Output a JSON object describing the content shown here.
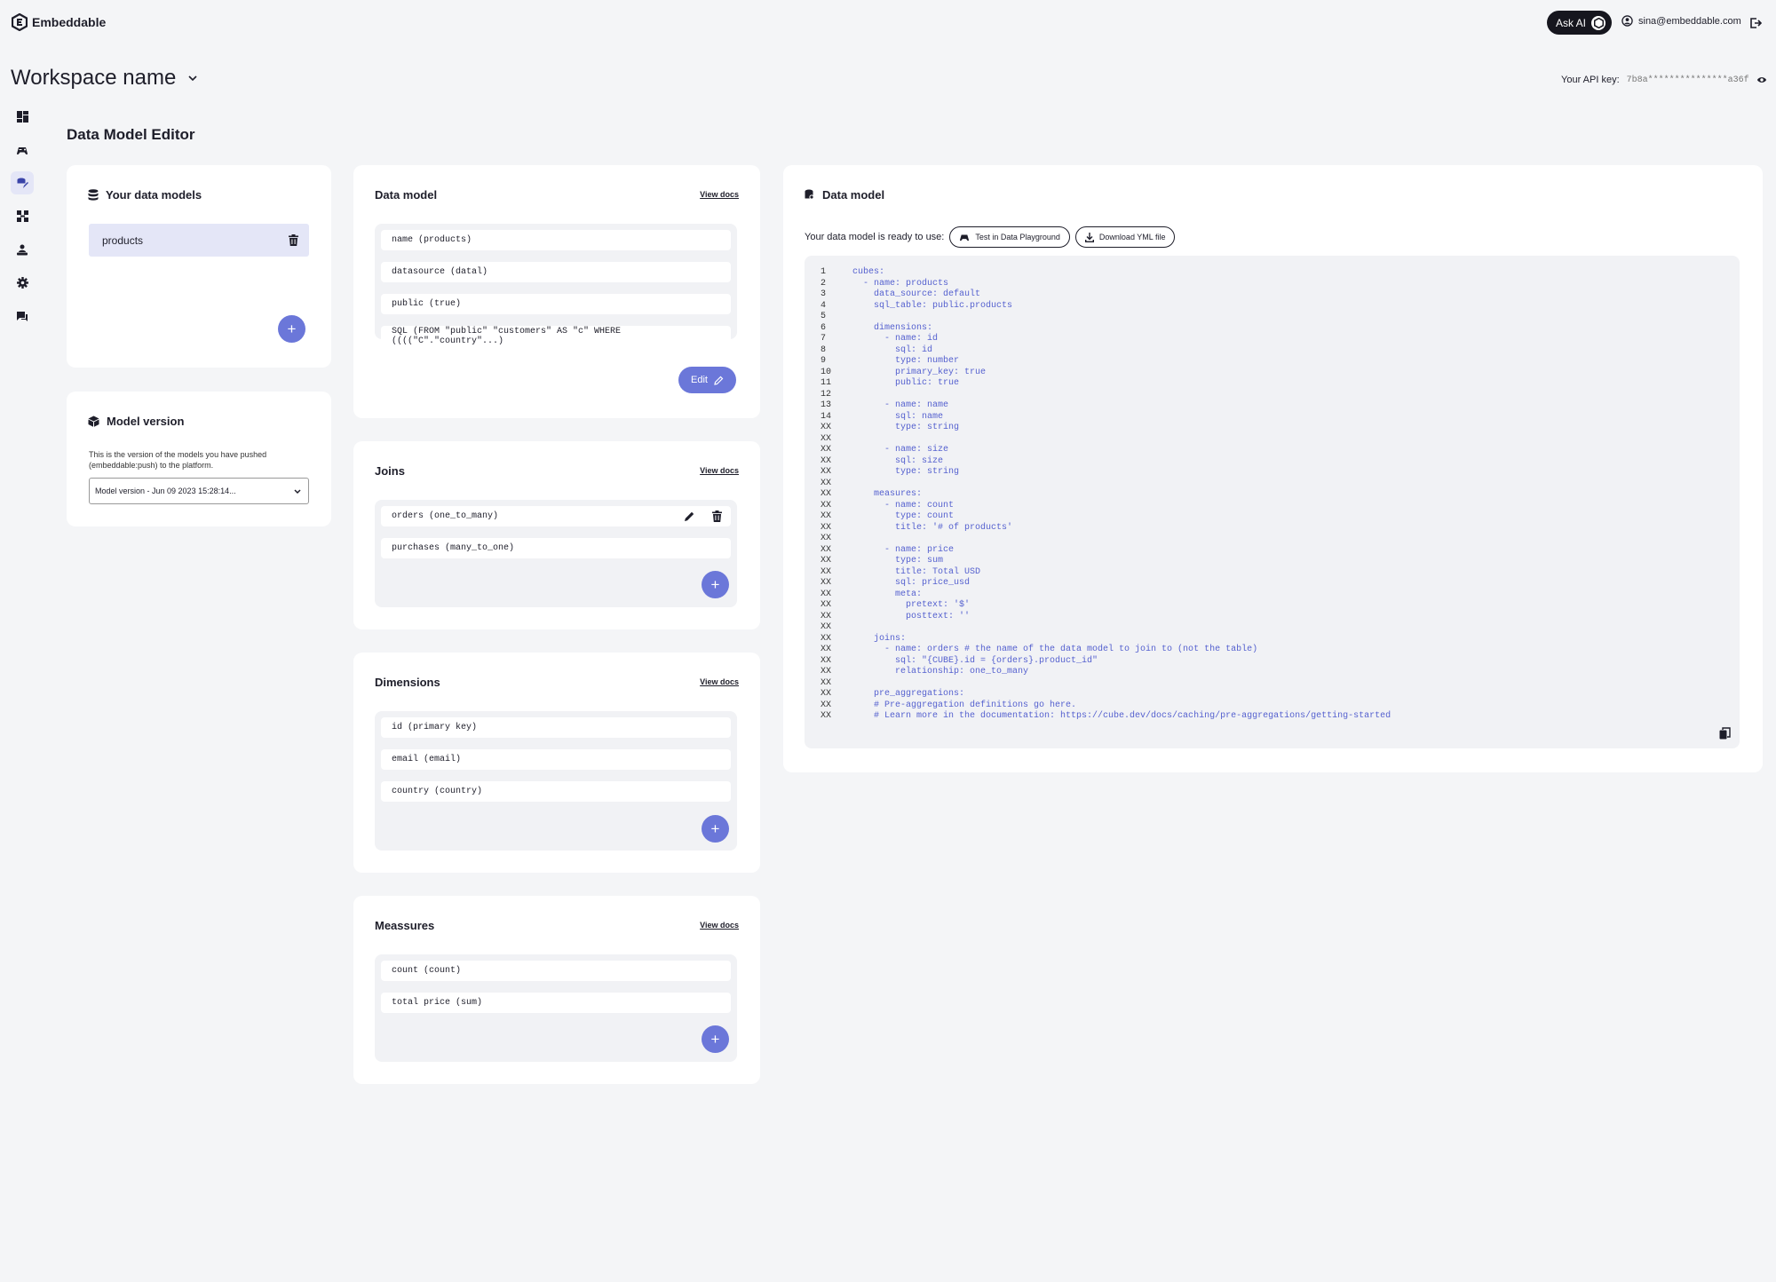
{
  "app": {
    "name": "Embeddable",
    "ask_ai": "Ask AI",
    "user_email": "sina@embeddable.com"
  },
  "workspace": {
    "name": "Workspace name",
    "api_key_label": "Your API key:",
    "api_key_value": "7b8a***************a36f"
  },
  "page": {
    "title": "Data Model Editor"
  },
  "sidenav": {
    "items": [
      "dashboard-icon",
      "playground-icon",
      "data-model-icon",
      "components-icon",
      "team-icon",
      "settings-icon",
      "support-icon"
    ],
    "active": "data-model-icon"
  },
  "your_models": {
    "title": "Your data models",
    "items": [
      {
        "label": "products"
      }
    ]
  },
  "model_version": {
    "title": "Model version",
    "description": "This is the version of the models you have pushed (embeddable:push) to the platform.",
    "selected": "Model version - Jun 09 2023 15:28:14..."
  },
  "data_model_card": {
    "title": "Data model",
    "view_docs": "View docs",
    "fields": [
      "name (products)",
      "datasource (datal)",
      "public (true)",
      "SQL (FROM \"public\" \"customers\" AS \"c\" WHERE ((((\"C\".\"country\"...)"
    ],
    "edit_label": "Edit"
  },
  "joins": {
    "title": "Joins",
    "view_docs": "View docs",
    "items": [
      "orders (one_to_many)",
      "purchases (many_to_one)"
    ]
  },
  "dimensions": {
    "title": "Dimensions",
    "view_docs": "View docs",
    "items": [
      "id (primary key)",
      "email (email)",
      "country (country)"
    ]
  },
  "measures": {
    "title": "Meassures",
    "view_docs": "View docs",
    "items": [
      "count (count)",
      "total price (sum)"
    ]
  },
  "yaml_panel": {
    "title": "Data model",
    "ready_text": "Your data model is ready to use:",
    "test_button": "Test in Data Playground",
    "download_button": "Download YML file",
    "lines": [
      {
        "n": "1",
        "t": "cubes:"
      },
      {
        "n": "2",
        "t": "  - name: products"
      },
      {
        "n": "3",
        "t": "    data_source: default"
      },
      {
        "n": "4",
        "t": "    sql_table: public.products"
      },
      {
        "n": "5",
        "t": ""
      },
      {
        "n": "6",
        "t": "    dimensions:"
      },
      {
        "n": "7",
        "t": "      - name: id"
      },
      {
        "n": "8",
        "t": "        sql: id"
      },
      {
        "n": "9",
        "t": "        type: number"
      },
      {
        "n": "10",
        "t": "        primary_key: true"
      },
      {
        "n": "11",
        "t": "        public: true"
      },
      {
        "n": "12",
        "t": ""
      },
      {
        "n": "13",
        "t": "      - name: name"
      },
      {
        "n": "14",
        "t": "        sql: name"
      },
      {
        "n": "XX",
        "t": "        type: string"
      },
      {
        "n": "XX",
        "t": ""
      },
      {
        "n": "XX",
        "t": "      - name: size"
      },
      {
        "n": "XX",
        "t": "        sql: size"
      },
      {
        "n": "XX",
        "t": "        type: string"
      },
      {
        "n": "XX",
        "t": ""
      },
      {
        "n": "XX",
        "t": "    measures:"
      },
      {
        "n": "XX",
        "t": "      - name: count"
      },
      {
        "n": "XX",
        "t": "        type: count"
      },
      {
        "n": "XX",
        "t": "        title: '# of products'"
      },
      {
        "n": "XX",
        "t": ""
      },
      {
        "n": "XX",
        "t": "      - name: price"
      },
      {
        "n": "XX",
        "t": "        type: sum"
      },
      {
        "n": "XX",
        "t": "        title: Total USD"
      },
      {
        "n": "XX",
        "t": "        sql: price_usd"
      },
      {
        "n": "XX",
        "t": "        meta:"
      },
      {
        "n": "XX",
        "t": "          pretext: '$'"
      },
      {
        "n": "XX",
        "t": "          posttext: ''"
      },
      {
        "n": "XX",
        "t": ""
      },
      {
        "n": "XX",
        "t": "    joins:"
      },
      {
        "n": "XX",
        "t": "      - name: orders # the name of the data model to join to (not the table)"
      },
      {
        "n": "XX",
        "t": "        sql: \"{CUBE}.id = {orders}.product_id\""
      },
      {
        "n": "XX",
        "t": "        relationship: one_to_many"
      },
      {
        "n": "XX",
        "t": ""
      },
      {
        "n": "XX",
        "t": "    pre_aggregations:"
      },
      {
        "n": "XX",
        "t": "    # Pre-aggregation definitions go here."
      },
      {
        "n": "XX",
        "t": "    # Learn more in the documentation: https://cube.dev/docs/caching/pre-aggregations/getting-started"
      }
    ]
  },
  "colors": {
    "accent": "#6b77d9",
    "code": "#5561cf",
    "dark": "#16161e",
    "background": "#f4f5f7"
  }
}
